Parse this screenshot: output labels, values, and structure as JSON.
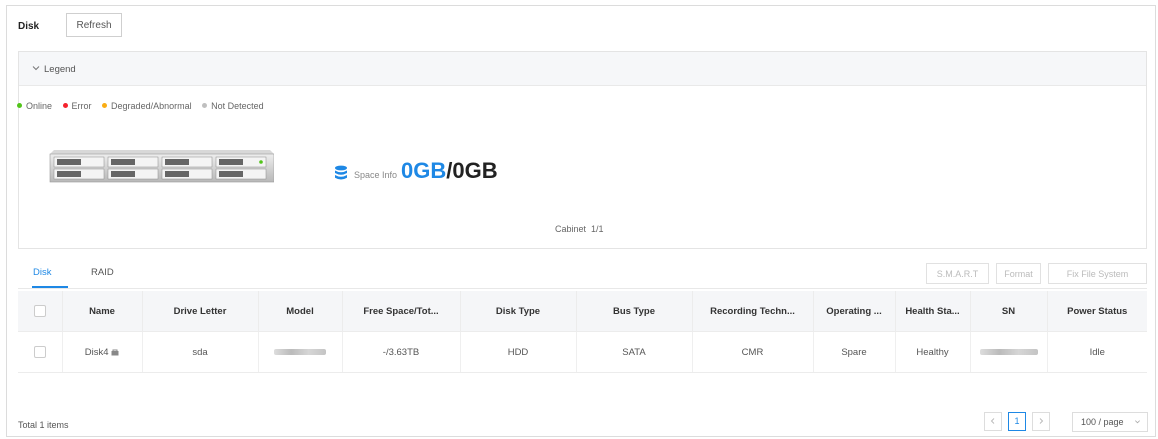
{
  "header": {
    "title": "Disk",
    "refresh_label": "Refresh"
  },
  "legend": {
    "toggle_label": "Legend",
    "statuses": [
      {
        "label": "Online",
        "color": "#52c41a"
      },
      {
        "label": "Error",
        "color": "#f5222d"
      },
      {
        "label": "Degraded/Abnormal",
        "color": "#faad14"
      },
      {
        "label": "Not Detected",
        "color": "#bfbfbf"
      }
    ],
    "space_label": "Space Info",
    "space_used": "0GB",
    "space_total": "/0GB",
    "cabinet_label": "Cabinet",
    "cabinet_value": "1/1"
  },
  "tabs": [
    {
      "label": "Disk",
      "active": true
    },
    {
      "label": "RAID",
      "active": false
    }
  ],
  "actions": {
    "smart": "S.M.A.R.T",
    "format": "Format",
    "fix": "Fix File System"
  },
  "table": {
    "columns": [
      "Name",
      "Drive Letter",
      "Model",
      "Free Space/Tot...",
      "Disk Type",
      "Bus Type",
      "Recording Techn...",
      "Operating ...",
      "Health Sta...",
      "SN",
      "Power Status"
    ],
    "rows": [
      {
        "name": "Disk4",
        "drive_letter": "sda",
        "model": "",
        "free_space": "-/3.63TB",
        "disk_type": "HDD",
        "bus_type": "SATA",
        "recording": "CMR",
        "operating": "Spare",
        "health": "Healthy",
        "sn": "",
        "power": "Idle"
      }
    ]
  },
  "footer": {
    "total": "Total 1 items",
    "current_page": "1",
    "page_size": "100 / page"
  },
  "colors": {
    "accent": "#1e88e5"
  }
}
